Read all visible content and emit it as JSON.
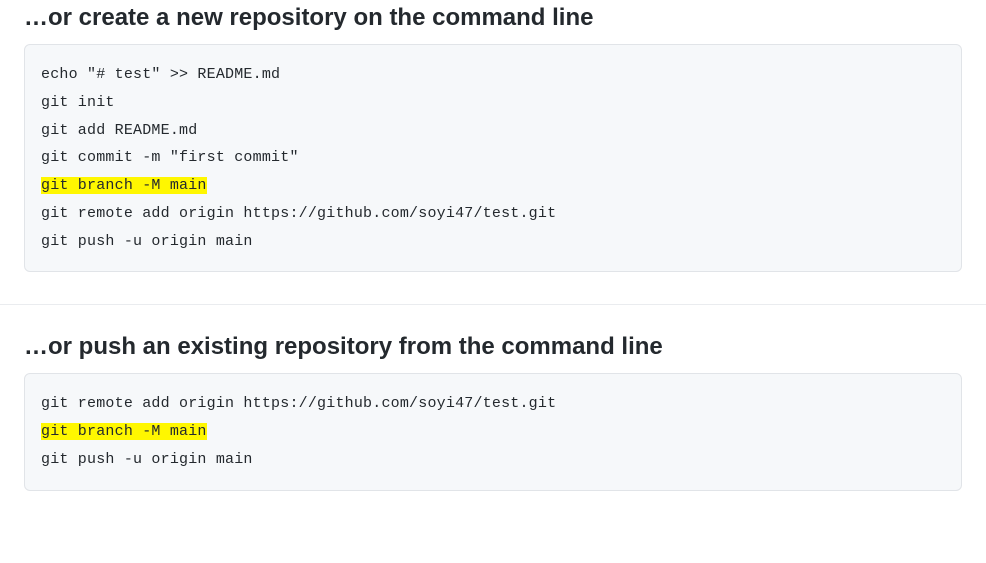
{
  "sections": [
    {
      "heading": "…or create a new repository on the command line",
      "lines": [
        {
          "text": "echo \"# test\" >> README.md",
          "highlight": false
        },
        {
          "text": "git init",
          "highlight": false
        },
        {
          "text": "git add README.md",
          "highlight": false
        },
        {
          "text": "git commit -m \"first commit\"",
          "highlight": false
        },
        {
          "text": "git branch -M main",
          "highlight": true
        },
        {
          "text": "git remote add origin https://github.com/soyi47/test.git",
          "highlight": false
        },
        {
          "text": "git push -u origin main",
          "highlight": false
        }
      ]
    },
    {
      "heading": "…or push an existing repository from the command line",
      "lines": [
        {
          "text": "git remote add origin https://github.com/soyi47/test.git",
          "highlight": false
        },
        {
          "text": "git branch -M main",
          "highlight": true
        },
        {
          "text": "git push -u origin main",
          "highlight": false
        }
      ]
    }
  ]
}
